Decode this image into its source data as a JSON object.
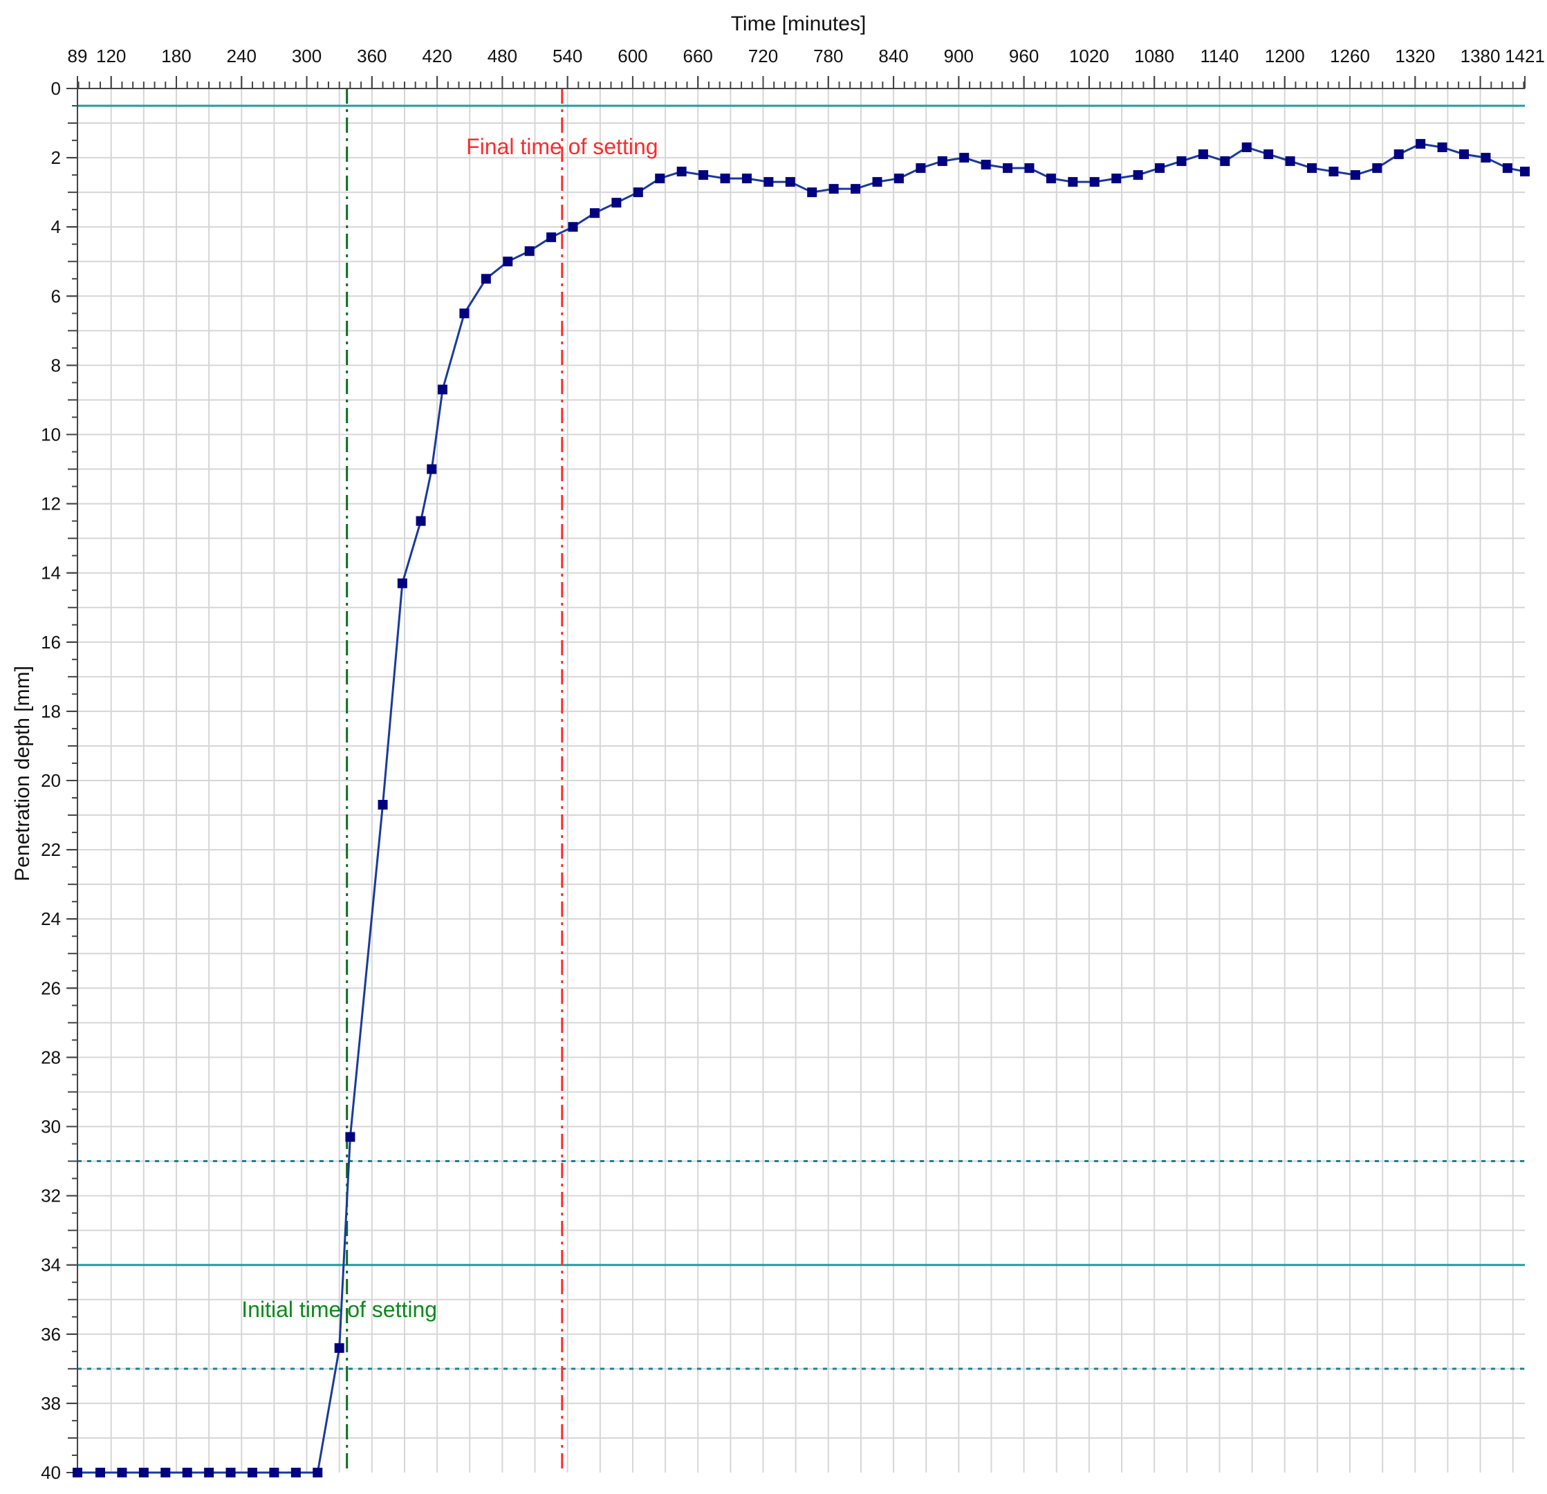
{
  "chart_data": {
    "type": "line",
    "xlabel": "Time [minutes]",
    "ylabel": "Penetration depth [mm]",
    "x_axis_position": "top",
    "y_axis_inverted": true,
    "xlim": [
      89,
      1421
    ],
    "ylim": [
      0,
      40
    ],
    "x_ticks": [
      89,
      120,
      180,
      240,
      300,
      360,
      420,
      480,
      540,
      600,
      660,
      720,
      780,
      840,
      900,
      960,
      1020,
      1080,
      1140,
      1200,
      1260,
      1320,
      1380,
      1421
    ],
    "y_ticks": [
      0,
      2,
      4,
      6,
      8,
      10,
      12,
      14,
      16,
      18,
      20,
      22,
      24,
      26,
      28,
      30,
      32,
      34,
      36,
      38,
      40
    ],
    "grid": true,
    "legend": "none",
    "series": [
      {
        "color": "#000080",
        "marker": "square",
        "x": [
          89,
          110,
          130,
          150,
          170,
          190,
          210,
          230,
          250,
          270,
          290,
          310,
          330,
          340,
          370,
          388,
          405,
          415,
          425,
          445,
          465,
          485,
          505,
          525,
          545,
          565,
          585,
          605,
          625,
          645,
          665,
          685,
          705,
          725,
          745,
          765,
          785,
          805,
          825,
          845,
          865,
          885,
          905,
          925,
          945,
          965,
          985,
          1005,
          1025,
          1045,
          1065,
          1085,
          1105,
          1125,
          1145,
          1165,
          1185,
          1205,
          1225,
          1245,
          1265,
          1285,
          1305,
          1325,
          1345,
          1365,
          1385,
          1405,
          1421
        ],
        "y": [
          40,
          40,
          40,
          40,
          40,
          40,
          40,
          40,
          40,
          40,
          40,
          40,
          36.4,
          30.3,
          20.7,
          14.3,
          12.5,
          11.0,
          8.7,
          6.5,
          5.5,
          5.0,
          4.7,
          4.3,
          4.0,
          3.6,
          3.3,
          3.0,
          2.6,
          2.4,
          2.5,
          2.6,
          2.6,
          2.7,
          2.7,
          3.0,
          2.9,
          2.9,
          2.7,
          2.6,
          2.3,
          2.1,
          2.0,
          2.2,
          2.3,
          2.3,
          2.6,
          2.7,
          2.7,
          2.6,
          2.5,
          2.3,
          2.1,
          1.9,
          2.1,
          1.7,
          1.9,
          2.1,
          2.3,
          2.4,
          2.5,
          2.3,
          1.9,
          1.6,
          1.7,
          1.9,
          2.0,
          2.3,
          2.4
        ]
      }
    ],
    "reference_lines": [
      {
        "name": "upper-limit-line",
        "axis": "y",
        "value": 0.5,
        "style": "solid",
        "color": "#1f9e9e"
      },
      {
        "name": "initial-threshold-line",
        "axis": "y",
        "value": 34,
        "style": "solid",
        "color": "#1f9e9e"
      },
      {
        "name": "initial-band-upper-line",
        "axis": "y",
        "value": 31,
        "style": "dotted",
        "color": "#1f7f9a"
      },
      {
        "name": "initial-band-lower-line",
        "axis": "y",
        "value": 37,
        "style": "dotted",
        "color": "#1f7f9a"
      },
      {
        "name": "initial-setting-marker-line",
        "axis": "x",
        "value": 337,
        "style": "dashdot",
        "color": "#0b6b1f"
      },
      {
        "name": "final-setting-marker-line",
        "axis": "x",
        "value": 535,
        "style": "dashdot",
        "color": "#ff2a2a"
      }
    ],
    "annotations": [
      {
        "name": "final-setting-annotation",
        "text": "Final time of setting",
        "x": 535,
        "y": 1.9,
        "color": "#ff2a2a"
      },
      {
        "name": "initial-setting-annotation",
        "text": "Initial time of setting",
        "x": 330,
        "y": 35.5,
        "color": "#0a8a1a"
      }
    ]
  }
}
